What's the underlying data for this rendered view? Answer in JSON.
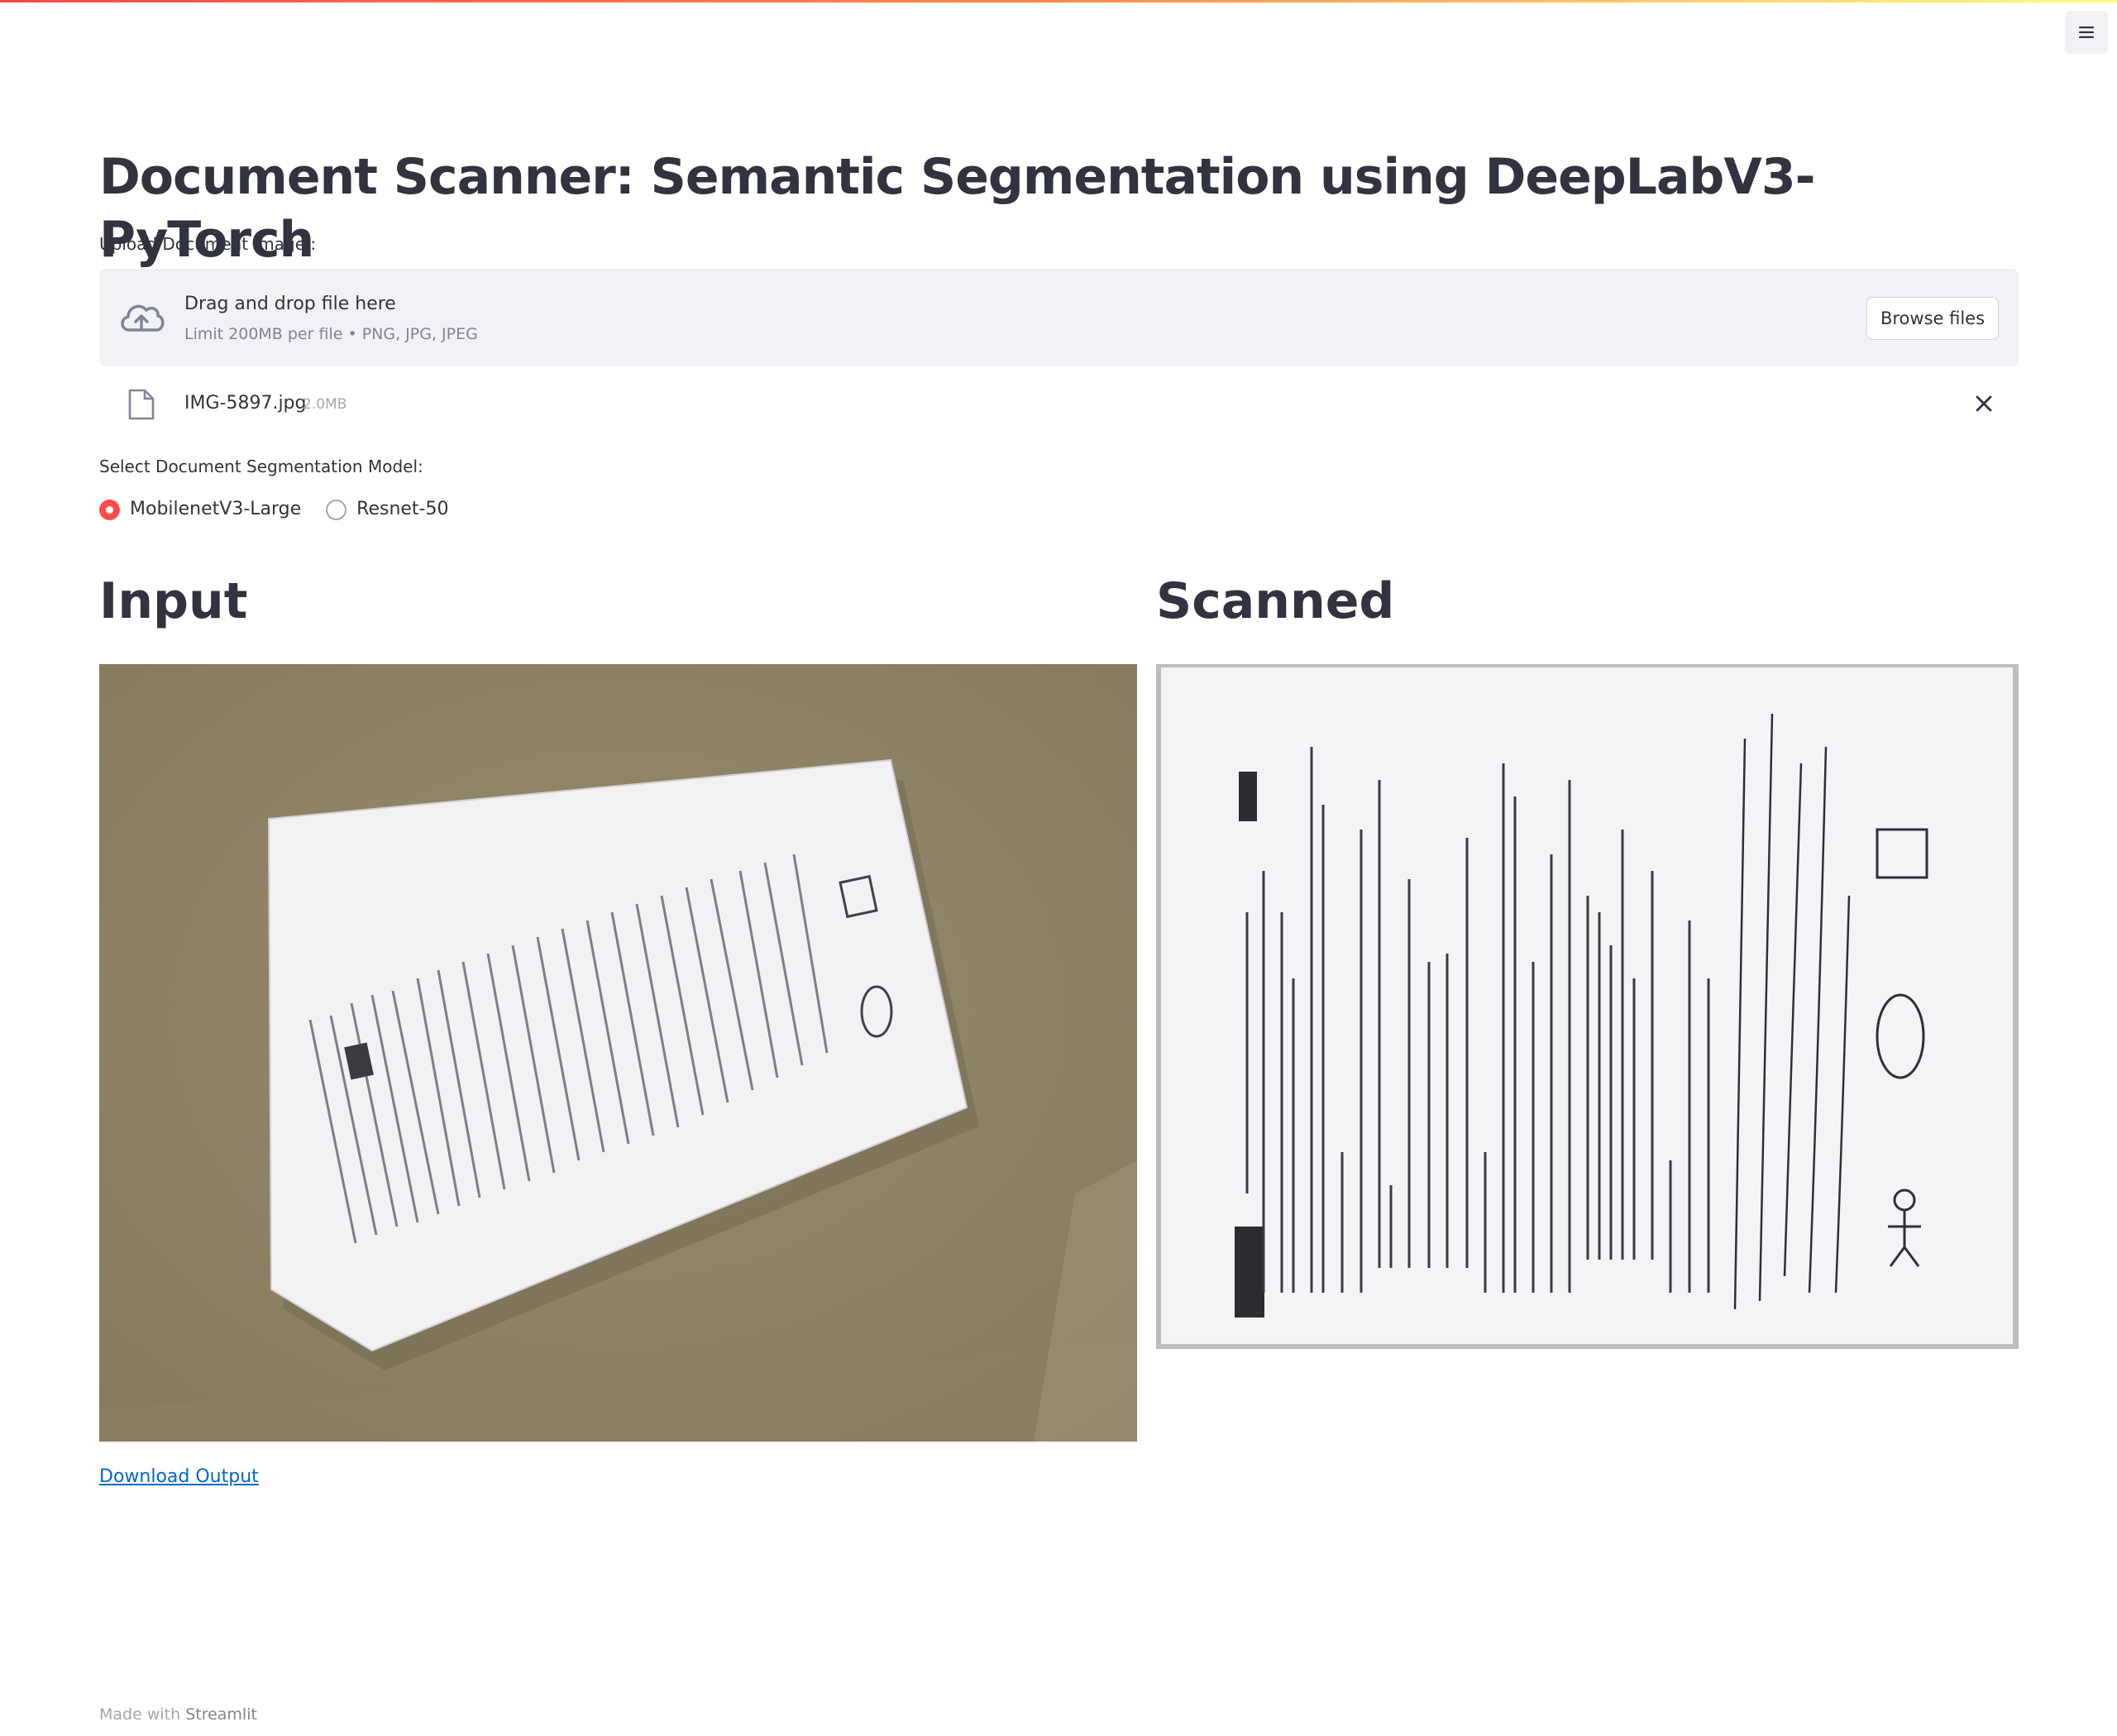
{
  "app": {
    "title": "Document Scanner: Semantic Segmentation using DeepLabV3-PyTorch",
    "accent_color": "#ff4b4b",
    "link_color": "#0068c9"
  },
  "header": {
    "menu_icon": "hamburger-menu-icon"
  },
  "uploader": {
    "label": "Upload Document Image :",
    "dropzone_title": "Drag and drop file here",
    "dropzone_subtitle": "Limit 200MB per file • PNG, JPG, JPEG",
    "browse_label": "Browse files",
    "icon": "cloud-upload-icon"
  },
  "uploaded_file": {
    "name": "IMG-5897.jpg",
    "size": "2.0MB",
    "icon": "file-icon",
    "remove_icon": "close-icon"
  },
  "model_select": {
    "label": "Select Document Segmentation Model:",
    "options": [
      "MobilenetV3-Large",
      "Resnet-50"
    ],
    "selected": "MobilenetV3-Large"
  },
  "input_section": {
    "title": "Input"
  },
  "scanned_section": {
    "title": "Scanned"
  },
  "download": {
    "label": "Download Output"
  },
  "footer": {
    "prefix": "Made with",
    "brand": "Streamlit"
  }
}
